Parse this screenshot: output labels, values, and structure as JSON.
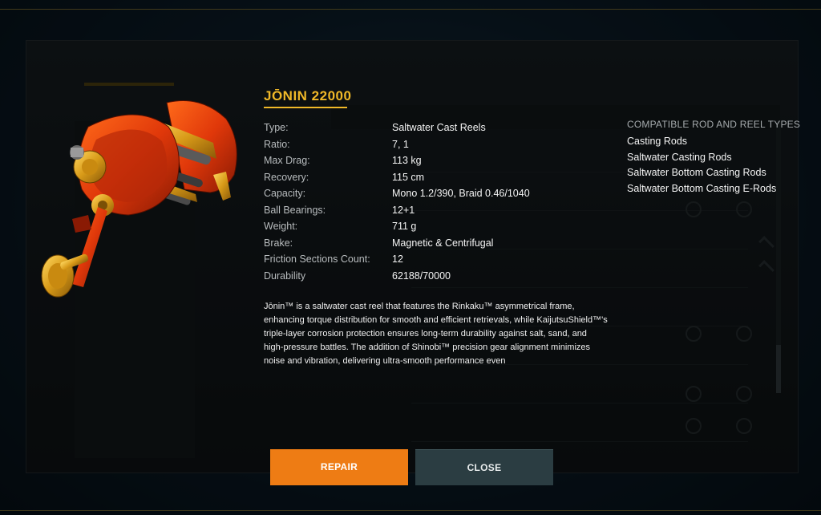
{
  "item": {
    "name": "JŌNIN 22000",
    "stats": [
      {
        "label": "Type:",
        "value": "Saltwater Cast Reels"
      },
      {
        "label": "Ratio:",
        "value": "7, 1"
      },
      {
        "label": "Max Drag:",
        "value": "113 kg"
      },
      {
        "label": "Recovery:",
        "value": "115 cm"
      },
      {
        "label": "Capacity:",
        "value": "Mono 1.2/390, Braid 0.46/1040"
      },
      {
        "label": "Ball Bearings:",
        "value": "12+1"
      },
      {
        "label": "Weight:",
        "value": "711 g"
      },
      {
        "label": "Brake:",
        "value": "Magnetic & Centrifugal"
      },
      {
        "label": "Friction Sections Count:",
        "value": "12"
      },
      {
        "label": "Durability",
        "value": "62188/70000"
      }
    ],
    "description": "Jōnin™ is a saltwater cast reel that features the Rinkaku™ asymmetrical frame, enhancing torque distribution for smooth and efficient retrievals, while KaijutsuShield™'s triple-layer corrosion protection ensures long-term durability against salt, sand, and high-pressure battles. The addition of Shinobi™ precision gear alignment minimizes noise and vibration, delivering ultra-smooth performance even"
  },
  "compatible": {
    "heading": "COMPATIBLE ROD AND REEL TYPES",
    "items": [
      "Casting Rods",
      "Saltwater Casting Rods",
      "Saltwater Bottom Casting Rods",
      "Saltwater Bottom Casting E-Rods"
    ]
  },
  "buttons": {
    "repair": "REPAIR",
    "close": "CLOSE"
  },
  "colors": {
    "accent": "#f0b828",
    "repair": "#ee7c14",
    "close": "#2b3d42"
  },
  "icons": {
    "reel": "reel-image"
  }
}
